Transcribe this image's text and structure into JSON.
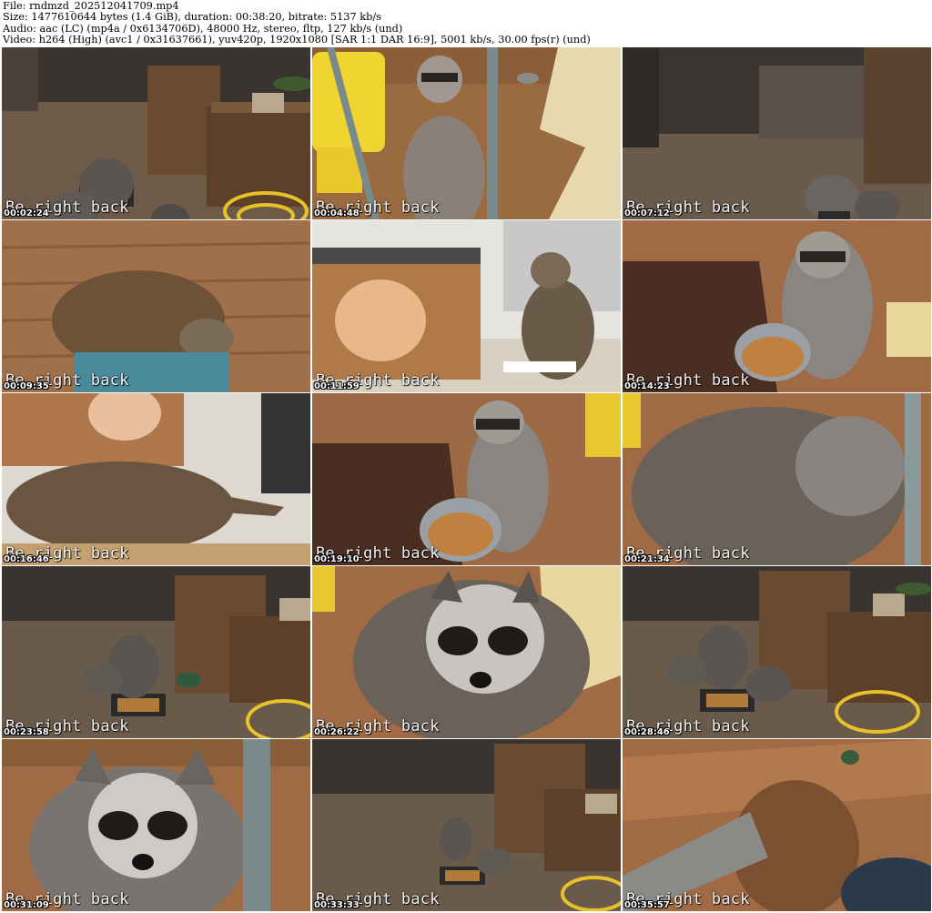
{
  "header": {
    "file": "File: rndmzd_202512041709.mp4",
    "size": "Size: 1477610644 bytes (1.4 GiB), duration: 00:38:20, bitrate: 5137 kb/s",
    "audio": "Audio: aac (LC) (mp4a / 0x6134706D), 48000 Hz, stereo, fltp, 127 kb/s (und)",
    "video": "Video: h264 (High) (avc1 / 0x31637661), yuv420p, 1920x1080 [SAR 1:1 DAR 16:9], 5001 kb/s, 30.00 fps(r) (und)"
  },
  "overlay_text": "Be right back",
  "thumbnails": [
    {
      "timestamp": "00:02:24"
    },
    {
      "timestamp": "00:04:48"
    },
    {
      "timestamp": "00:07:12"
    },
    {
      "timestamp": "00:09:35"
    },
    {
      "timestamp": "00:11:59"
    },
    {
      "timestamp": "00:14:23"
    },
    {
      "timestamp": "00:16:46"
    },
    {
      "timestamp": "00:19:10"
    },
    {
      "timestamp": "00:21:34"
    },
    {
      "timestamp": "00:23:58"
    },
    {
      "timestamp": "00:26:22"
    },
    {
      "timestamp": "00:28:46"
    },
    {
      "timestamp": "00:31:09"
    },
    {
      "timestamp": "00:33:33"
    },
    {
      "timestamp": "00:35:57"
    }
  ]
}
